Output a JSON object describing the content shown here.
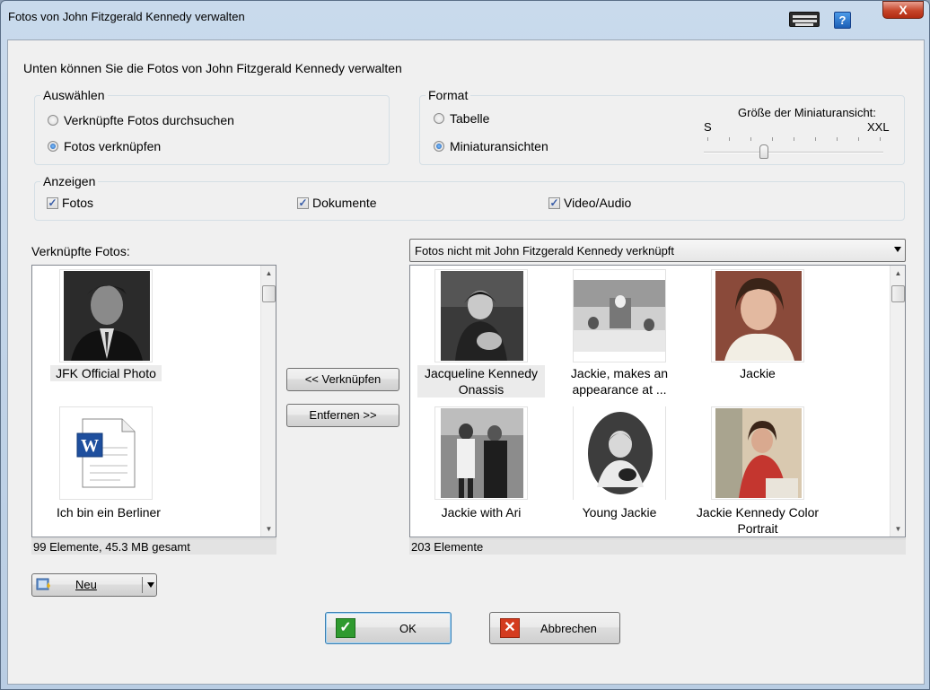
{
  "window": {
    "title": "Fotos von John Fitzgerald Kennedy verwalten",
    "help_label": "?",
    "close_label": "X"
  },
  "intro": "Unten können Sie die Fotos von John Fitzgerald Kennedy verwalten",
  "select_group": {
    "legend": "Auswählen",
    "options": [
      "Verknüpfte Fotos durchsuchen",
      "Fotos verknüpfen"
    ],
    "selected": "Fotos verknüpfen"
  },
  "format_group": {
    "legend": "Format",
    "options": [
      "Tabelle",
      "Miniaturansichten"
    ],
    "selected": "Miniaturansichten",
    "thumb_size": {
      "label": "Größe der Miniaturansicht:",
      "min_label": "S",
      "max_label": "XXL",
      "level": 0.33
    }
  },
  "show_group": {
    "legend": "Anzeigen",
    "items": [
      {
        "label": "Fotos",
        "checked": true
      },
      {
        "label": "Dokumente",
        "checked": true
      },
      {
        "label": "Video/Audio",
        "checked": true
      }
    ]
  },
  "linked": {
    "label": "Verknüpfte Fotos:",
    "items": [
      "JFK Official Photo",
      "Ich bin ein Berliner"
    ],
    "status": "99 Elemente, 45.3 MB gesamt"
  },
  "unlinked": {
    "filter": "Fotos nicht mit John Fitzgerald Kennedy verknüpft",
    "items": [
      "Jacqueline Kennedy Onassis",
      "Jackie, makes an appearance at ...",
      "Jackie",
      "Jackie with Ari",
      "Young Jackie",
      "Jackie Kennedy Color Portrait"
    ],
    "status": "203 Elemente"
  },
  "buttons": {
    "link": "<< Verknüpfen",
    "remove": "Entfernen >>",
    "new": "Neu",
    "ok": "OK",
    "cancel": "Abbrechen"
  },
  "icons": {
    "ok": "check-icon",
    "cancel": "x-icon",
    "new": "new-photo-icon",
    "doc": "word-document-icon"
  },
  "colors": {
    "ok_green": "#2f9a2f",
    "cancel_red": "#d43b1f",
    "selection": "#ebebeb"
  }
}
